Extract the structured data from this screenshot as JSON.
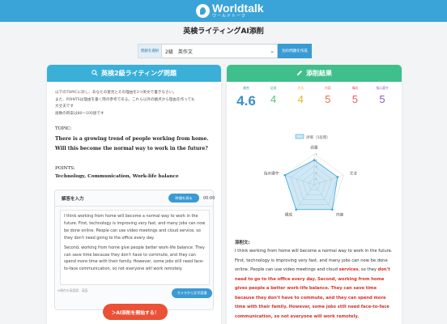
{
  "header": {
    "logo_main": "Worldtalk",
    "logo_sub": "ワールドトーク"
  },
  "page_title": "英検ライティングAI添削",
  "selector": {
    "label": "問題を選択",
    "value": "2級　英作文",
    "new_button": "別の問題を作成"
  },
  "left_panel": {
    "title": "英検2級ライティング問題",
    "instructions": [
      "以下のTOPICに対し、あなたの意見とその理由を2つ英文で書きなさい。",
      "また、POINTSは理由を書く際の参考である。これら以外の観点から理由を作っても",
      "大丈夫です",
      "語数の目安は80〜100語です"
    ],
    "topic_label": "TOPIC:",
    "topic_text": "There is a growing trend of people working from home. Will this become the normal way to work in the future?",
    "points_label": "POINTS:",
    "points_text": "Technology, Communication, Work-life balance",
    "answer": {
      "title": "解答を入力",
      "timer_button": "時間を測る",
      "timer_value": "00:00",
      "paragraphs": [
        "I think working from home will become a normal way to work in the future. First, technology is improving very fast, and many jobs can now be done online. People can use video meetings and cloud service, so they don't need going to the office every day.",
        "Second, working from home give people better work-life balance. They can save time because they don't have to commute, and they can spend more time with their family. However, some jobs still need face-to-face communication, so not everyone will work remotely."
      ],
      "note": "※現在の英語版：英語",
      "camera_button": "カメラから文字認識"
    },
    "submit_button": "＞AI添削を開始する！"
  },
  "right_panel": {
    "title": "添削結果",
    "scores": [
      {
        "label": "総合",
        "value": "4.6",
        "color": "#3a8fc7"
      },
      {
        "label": "語彙",
        "value": "4",
        "color": "#5cbf84"
      },
      {
        "label": "文法",
        "value": "4",
        "color": "#e0b52a"
      },
      {
        "label": "内容",
        "value": "5",
        "color": "#e9704a"
      },
      {
        "label": "構成",
        "value": "5",
        "color": "#e55a72"
      },
      {
        "label": "指示遵守",
        "value": "5",
        "color": "#8a5bc9"
      }
    ],
    "chart_data": {
      "type": "radar",
      "legend": "評価（5段階）",
      "axes": [
        "語彙",
        "文法",
        "内容",
        "構成",
        "指示遵守"
      ],
      "values": [
        4,
        4,
        5,
        5,
        5
      ],
      "ticks": [
        "1",
        "2",
        "3",
        "4",
        "5"
      ],
      "range": [
        0,
        5
      ],
      "color": "#3aa4d8"
    },
    "corrected_label": "添削文:",
    "corrected_segments": [
      {
        "text": "I think working from home will become a normal way to work in the future. First, technology is improving very fast, and many jobs can now be done online. People can use video meetings and cloud ",
        "red": false
      },
      {
        "text": "services",
        "red": true
      },
      {
        "text": ", so they ",
        "red": false
      },
      {
        "text": "don't need to go to the office every day. Second, working from home gives people a better work-life balance. They can save time because they don't have to commute, and they can spend more time with their family. However, some jobs still need face-to-face communication, so not everyone will work remotely.",
        "red": true
      }
    ]
  }
}
